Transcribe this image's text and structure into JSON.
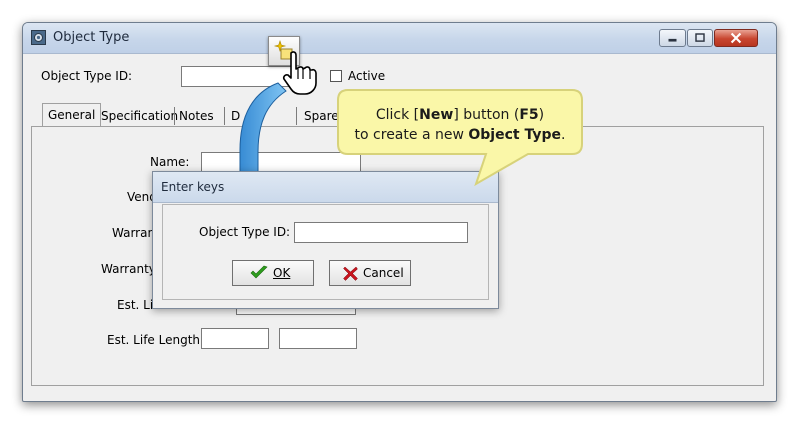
{
  "window": {
    "title": "Object Type",
    "id_label": "Object Type ID:",
    "id_value": "",
    "active_label": "Active",
    "active_checked": false
  },
  "tabs": [
    {
      "label": "General",
      "active": true
    },
    {
      "label": "Specification"
    },
    {
      "label": "Notes"
    },
    {
      "label": "Documents",
      "visible_text": "D"
    },
    {
      "label": "Spare p"
    }
  ],
  "general": {
    "name_label": "Name:",
    "vendor_label": "Vend",
    "warranty_label": "Warran",
    "warranty2_label": "Warranty",
    "est_life_type_label": "Est. Lif",
    "est_life_length_label": "Est. Life Length:"
  },
  "dialog": {
    "title": "Enter keys",
    "id_label": "Object Type ID:",
    "id_value": "",
    "ok_label": "OK",
    "cancel_label": "Cancel"
  },
  "callout": {
    "line1_prefix": "Click [",
    "line1_bold": "New",
    "line1_mid": "] button (",
    "line1_key": "F5",
    "line1_suffix": ")",
    "line2_prefix": "to create a new ",
    "line2_bold": "Object Type",
    "line2_suffix": "."
  },
  "colors": {
    "callout_fill": "#faf7a8",
    "callout_border": "#d7d27a",
    "arrow_fill": "#3d9ee3",
    "ok_check": "#2e9e1e",
    "cancel_x": "#c8141e"
  }
}
